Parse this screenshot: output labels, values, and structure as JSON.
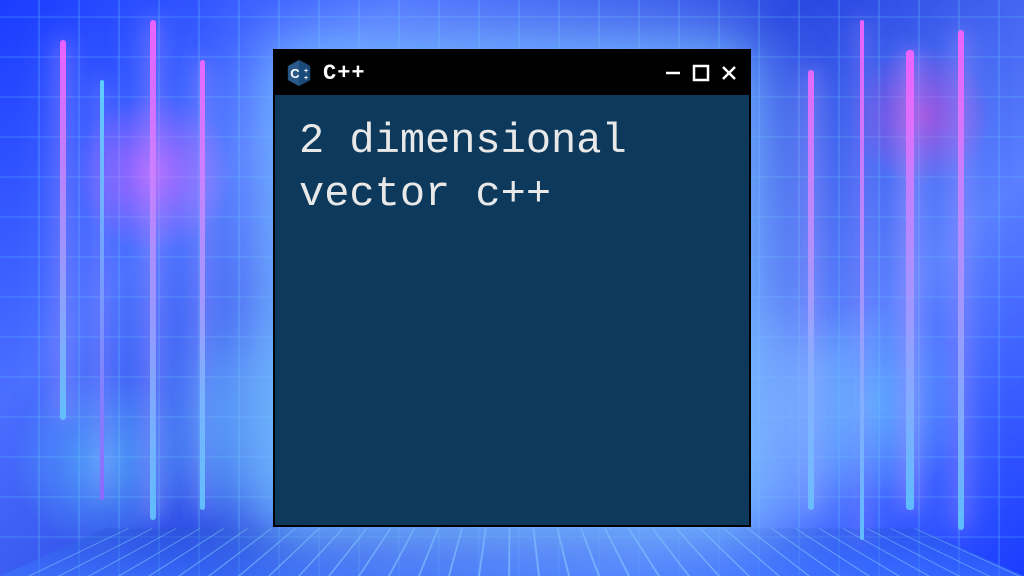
{
  "window": {
    "title": "C++",
    "icon": "cpp-icon"
  },
  "content": {
    "text": "2 dimensional vector c++"
  },
  "controls": {
    "minimize": "minimize",
    "maximize": "maximize",
    "close": "close"
  }
}
